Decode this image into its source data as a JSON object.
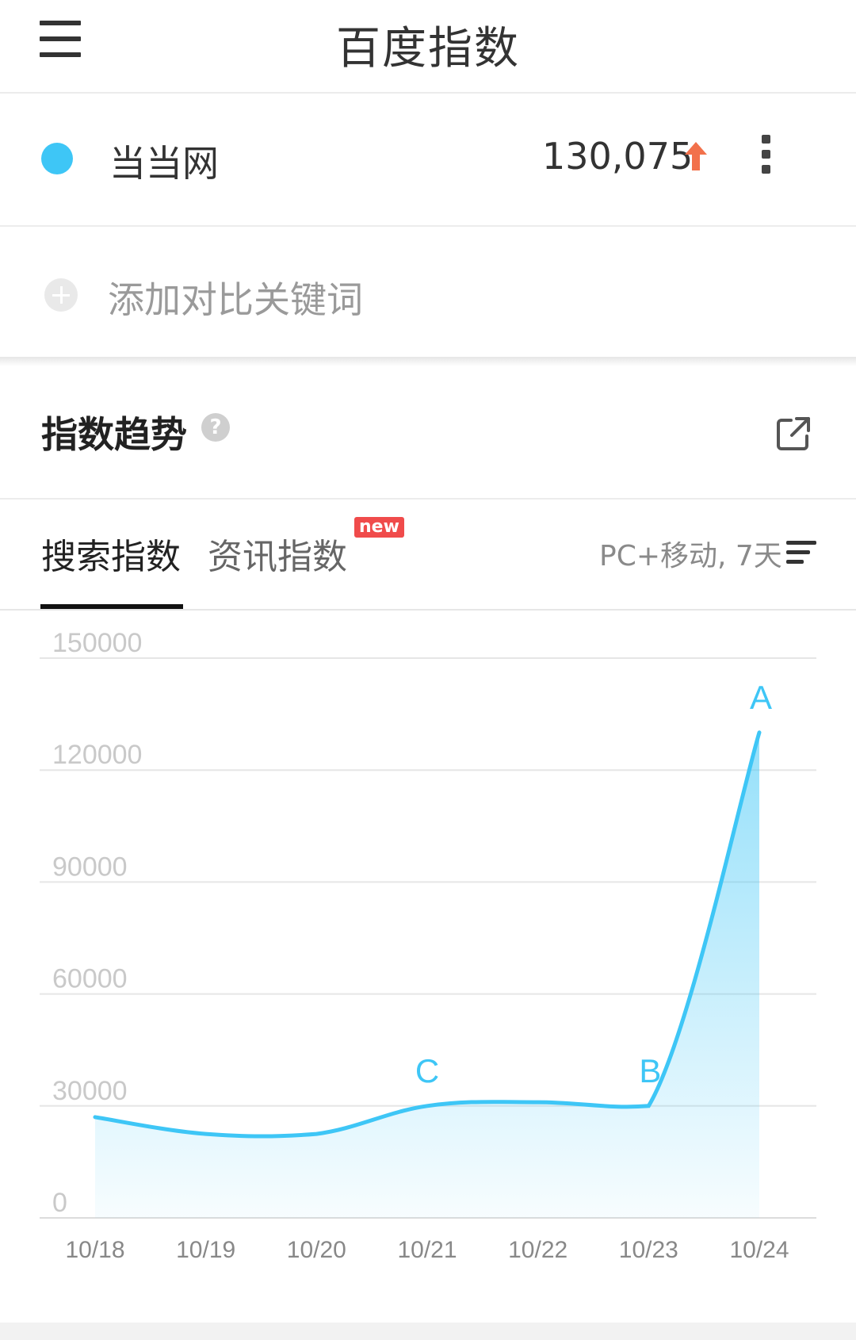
{
  "header": {
    "title": "百度指数",
    "menu_icon": "hamburger-menu-icon"
  },
  "keyword": {
    "name": "当当网",
    "value": "130,075",
    "trend": "up",
    "dot_color": "#3ec6f6",
    "up_color": "#f2714b",
    "more_icon": "more-vertical-icon"
  },
  "compare": {
    "label": "添加对比关键词",
    "icon": "plus-circle-icon"
  },
  "trend_section": {
    "title": "指数趋势",
    "help_icon": "question-icon",
    "help_glyph": "?",
    "share_icon": "share-external-icon"
  },
  "tabs": {
    "search": "搜索指数",
    "news": "资讯指数",
    "new_badge": "new",
    "filter_label": "PC+移动, 7天",
    "filter_icon": "sort-lines-icon"
  },
  "chart_data": {
    "type": "area",
    "title": "",
    "xlabel": "",
    "ylabel": "",
    "categories": [
      "10/18",
      "10/19",
      "10/20",
      "10/21",
      "10/22",
      "10/23",
      "10/24"
    ],
    "y_ticks": [
      "0",
      "30000",
      "60000",
      "90000",
      "120000",
      "150000"
    ],
    "ylim": [
      0,
      150000
    ],
    "grid": true,
    "line_color": "#3ec6f6",
    "points": [
      {
        "x": "10/18",
        "y": 27000
      },
      {
        "x": "10/19",
        "y": 22500
      },
      {
        "x": "10/20",
        "y": 22500
      },
      {
        "x": "10/21",
        "y": 30000
      },
      {
        "x": "10/22",
        "y": 31000
      },
      {
        "x": "10/23",
        "y": 30000
      },
      {
        "x": "10/24",
        "y": 130075
      }
    ],
    "annotations": [
      {
        "label": "C",
        "x": "10/21"
      },
      {
        "label": "B",
        "x": "10/23"
      },
      {
        "label": "A",
        "x": "10/24"
      }
    ]
  }
}
